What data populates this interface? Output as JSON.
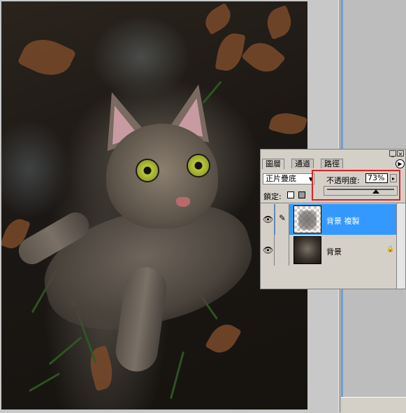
{
  "panel": {
    "tabs": [
      {
        "label": "圖層",
        "active": true
      },
      {
        "label": "通道",
        "active": false
      },
      {
        "label": "路徑",
        "active": false
      }
    ],
    "titlebar_buttons": [
      "_",
      "×"
    ],
    "menu_arrow": "▶",
    "blend_mode": "正片疊底",
    "opacity_label": "不透明度:",
    "opacity_value": "73%",
    "opacity_arrow": "▸",
    "opacity_fraction": 0.73,
    "lock_label": "鎖定:",
    "layers": [
      {
        "name": "背景 複製",
        "selected": true,
        "visible_icon": "👁",
        "brush_icon": "✎",
        "thumb": "transparent"
      },
      {
        "name": "背景",
        "selected": false,
        "visible_icon": "👁",
        "lock_icon": "🔒",
        "thumb": "photo"
      }
    ]
  },
  "colors": {
    "selection": "#3399ff",
    "highlight_box": "#e02020",
    "panel_bg": "#d4d0c8"
  },
  "icons": [
    "eye-icon",
    "brush-icon",
    "lock-icon",
    "panel-menu-icon",
    "dropdown-arrow-icon",
    "minimize-icon",
    "close-icon"
  ]
}
